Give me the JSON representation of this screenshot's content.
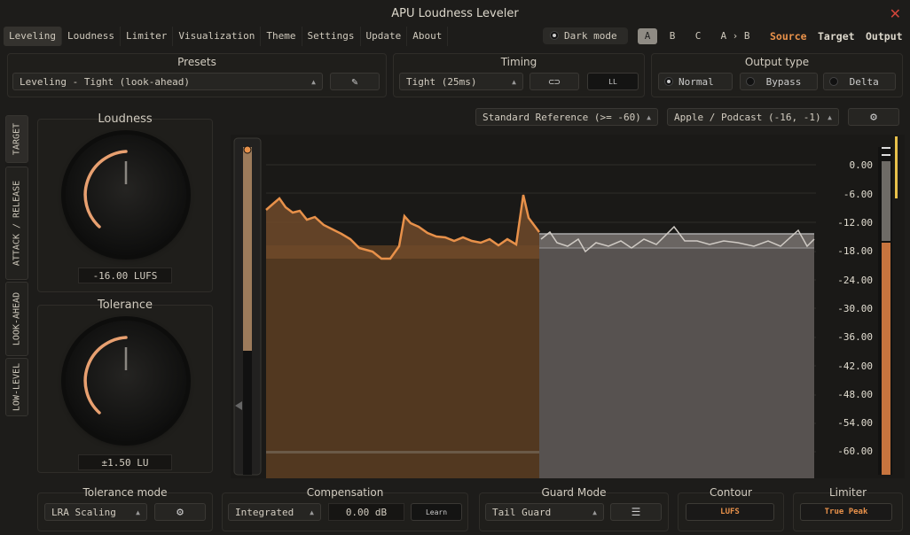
{
  "title": "APU Loudness Leveler",
  "menu": [
    "Leveling",
    "Loudness",
    "Limiter",
    "Visualization",
    "Theme",
    "Settings",
    "Update",
    "About"
  ],
  "dark_mode": "Dark mode",
  "ab": {
    "a": "A",
    "b": "B",
    "c": "C",
    "atob": "A › B"
  },
  "view": {
    "source": "Source",
    "target": "Target",
    "output": "Output"
  },
  "presets": {
    "title": "Presets",
    "value": "Leveling - Tight (look-ahead)"
  },
  "timing": {
    "title": "Timing",
    "value": "Tight (25ms)",
    "ll": "LL"
  },
  "output_type": {
    "title": "Output type",
    "options": [
      "Normal",
      "Bypass",
      "Delta"
    ],
    "selected": "Normal"
  },
  "reference": "Standard Reference (>= -60)",
  "platform": "Apple / Podcast (-16, -1)",
  "side_tabs": [
    "TARGET",
    "ATTACK / RELEASE",
    "LOOK-AHEAD",
    "LOW-LEVEL"
  ],
  "loudness": {
    "title": "Loudness",
    "value": "-16.00 LUFS"
  },
  "tolerance": {
    "title": "Tolerance",
    "value": "±1.50 LU"
  },
  "chart_data": {
    "type": "area",
    "y_ticks": [
      "0.00",
      "-6.00",
      "-12.00",
      "-18.00",
      "-24.00",
      "-30.00",
      "-36.00",
      "-42.00",
      "-48.00",
      "-54.00",
      "-60.00"
    ],
    "ylim": [
      -60,
      0
    ],
    "grid": true
  },
  "tolerance_mode": {
    "title": "Tolerance mode",
    "value": "LRA Scaling"
  },
  "compensation": {
    "title": "Compensation",
    "mode": "Integrated",
    "value": "0.00 dB",
    "learn": "Learn"
  },
  "guard": {
    "title": "Guard Mode",
    "value": "Tail Guard"
  },
  "contour": {
    "title": "Contour",
    "value": "LUFS"
  },
  "limiter": {
    "title": "Limiter",
    "value": "True Peak"
  },
  "colors": {
    "accent": "#e8914a",
    "source": "#e8914a",
    "close": "#d2453a"
  }
}
